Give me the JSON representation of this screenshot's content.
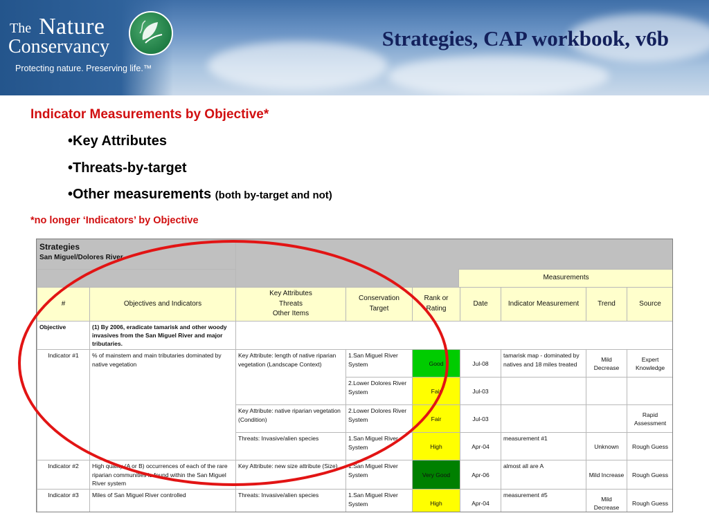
{
  "header": {
    "logo_the": "The",
    "logo_nature": "Nature",
    "logo_conservancy": "Conservancy",
    "logo_tagline": "Protecting nature. Preserving life.™",
    "title": "Strategies, CAP workbook, v6b"
  },
  "content": {
    "heading": "Indicator Measurements by Objective*",
    "bullets": {
      "b1": "•Key Attributes",
      "b2": "•Threats-by-target",
      "b3": "•Other measurements",
      "b3_note": "(both by-target and not)"
    },
    "footnote": "*no longer ‘Indicators’ by Objective"
  },
  "sheet": {
    "title": "Strategies",
    "subtitle": "San Miguel/Dolores River",
    "measurements_label": "Measurements",
    "headers": {
      "num": "#",
      "objectives": "Objectives and Indicators",
      "key_attr_1": "Key Attributes",
      "key_attr_2": "Threats",
      "key_attr_3": "Other Items",
      "target_1": "Conservation",
      "target_2": "Target",
      "rank_1": "Rank or",
      "rank_2": "Rating",
      "date": "Date",
      "indicator_measurement": "Indicator Measurement",
      "trend": "Trend",
      "source": "Source"
    },
    "objective_row": {
      "label": "Objective",
      "text": "(1) By 2006, eradicate tamarisk and other woody invasives from the San Miguel River and major tributaries."
    },
    "rows": [
      {
        "num": "Indicator #1",
        "objective": "% of mainstem and main tributaries dominated by native vegetation",
        "attr": "Key Attribute: length of native riparian vegetation (Landscape Context)",
        "target": "1.San Miguel River System",
        "rank": "Good",
        "date": "Jul-08",
        "measurement": "tamarisk map - dominated by natives and 18 miles treated",
        "trend": "Mild Decrease",
        "source": "Expert Knowledge"
      },
      {
        "target": "2.Lower Dolores River System",
        "rank": "Fair",
        "date": "Jul-03"
      },
      {
        "attr": "Key Attribute: native riparian vegetation (Condition)",
        "target": "2.Lower Dolores River System",
        "rank": "Fair",
        "date": "Jul-03",
        "source": "Rapid Assessment"
      },
      {
        "attr": "Threats: Invasive/alien species",
        "target": "1.San Miguel River System",
        "rank": "High",
        "date": "Apr-04",
        "measurement": "measurement #1",
        "trend": "Unknown",
        "source": "Rough Guess"
      },
      {
        "num": "Indicator #2",
        "objective": "High quality (A or B) occurrences of each of the rare riparian communities is found within the San Miguel River system",
        "attr": "Key Attribute: new size attribute (Size)",
        "target": "1.San Miguel River System",
        "rank": "Very Good",
        "date": "Apr-06",
        "measurement": "almost all are A",
        "trend": "Mild Increase",
        "source": "Rough Guess"
      },
      {
        "num": "Indicator #3",
        "objective": "Miles of San Miguel River controlled",
        "attr": "Threats: Invasive/alien species",
        "target": "1.San Miguel River System",
        "rank": "High",
        "date": "Apr-04",
        "measurement": "measurement #5",
        "trend": "Mild Decrease",
        "source": "Rough Guess"
      }
    ]
  },
  "colors": {
    "title_navy": "#13205b",
    "accent_red": "#d10f10",
    "rating_good": "#00cc00",
    "rating_fair": "#ffff00",
    "rating_very_good": "#008000",
    "header_yellow": "#ffffcc"
  }
}
